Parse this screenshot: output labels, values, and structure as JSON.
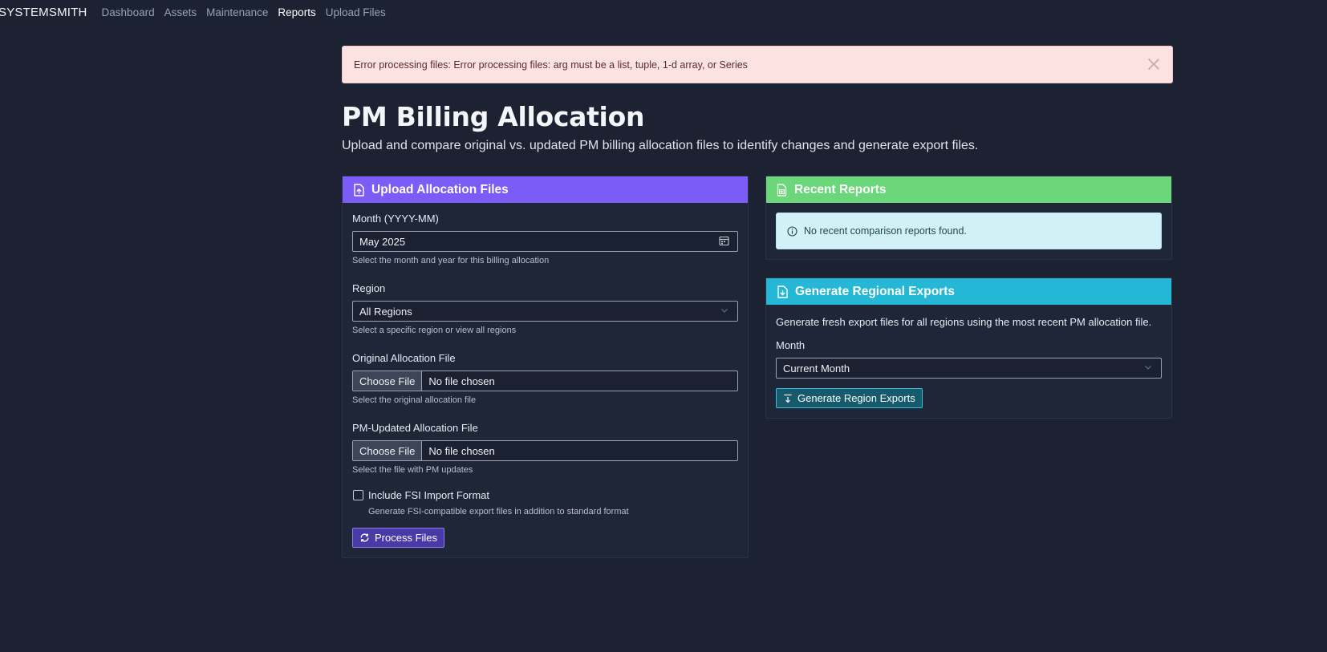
{
  "nav": {
    "brand": "SYSTEMSMITH",
    "links": [
      "Dashboard",
      "Assets",
      "Maintenance",
      "Reports",
      "Upload Files"
    ],
    "active": "Reports"
  },
  "alert": {
    "message": "Error processing files: Error processing files: arg must be a list, tuple, 1-d array, or Series"
  },
  "page": {
    "title": "PM Billing Allocation",
    "lead": "Upload and compare original vs. updated PM billing allocation files to identify changes and generate export files."
  },
  "upload_card": {
    "title": "Upload Allocation Files",
    "month_label": "Month (YYYY-MM)",
    "month_value": "May 2025",
    "month_help": "Select the month and year for this billing allocation",
    "region_label": "Region",
    "region_value": "All Regions",
    "region_help": "Select a specific region or view all regions",
    "original_label": "Original Allocation File",
    "original_btn": "Choose File",
    "original_status": "No file chosen",
    "original_help": "Select the original allocation file",
    "updated_label": "PM-Updated Allocation File",
    "updated_btn": "Choose File",
    "updated_status": "No file chosen",
    "updated_help": "Select the file with PM updates",
    "fsi_label": "Include FSI Import Format",
    "fsi_help": "Generate FSI-compatible export files in addition to standard format",
    "fsi_checked": false,
    "process_btn": "Process Files"
  },
  "recent_card": {
    "title": "Recent Reports",
    "empty_message": "No recent comparison reports found."
  },
  "exports_card": {
    "title": "Generate Regional Exports",
    "description": "Generate fresh export files for all regions using the most recent PM allocation file.",
    "month_label": "Month",
    "month_value": "Current Month",
    "generate_btn": "Generate Region Exports"
  },
  "colors": {
    "background": "#1c2232",
    "upload_header": "#7b5cf7",
    "recent_header": "#6bd67a",
    "exports_header": "#25b7d6",
    "alert_bg": "#fde2e2",
    "info_bg": "#d2f1f7"
  },
  "icons": {
    "upload_header": "file-upload-icon",
    "recent_header": "spreadsheet-icon",
    "exports_header": "file-download-icon",
    "month_field": "calendar-icon",
    "select": "chevron-down-icon",
    "info": "info-circle-icon",
    "process": "refresh-icon",
    "generate": "download-icon",
    "alert": "close-icon"
  }
}
